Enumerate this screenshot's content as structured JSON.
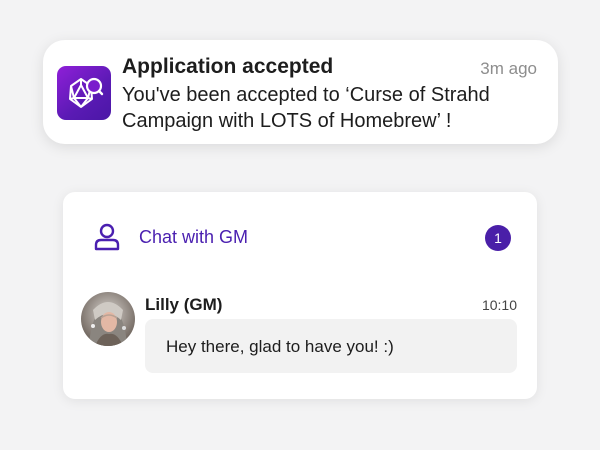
{
  "notification": {
    "title": "Application accepted",
    "time": "3m ago",
    "body": "You've been accepted to ‘Curse of Strahd Campaign with LOTS of Homebrew’ !",
    "icon": "d20-search-icon",
    "accent": "#6a1cc4"
  },
  "chat": {
    "title": "Chat with GM",
    "unread_count": "1",
    "accent": "#4a1fa8",
    "message": {
      "sender": "Lilly (GM)",
      "time": "10:10",
      "text": "Hey there, glad to have you! :)"
    }
  }
}
